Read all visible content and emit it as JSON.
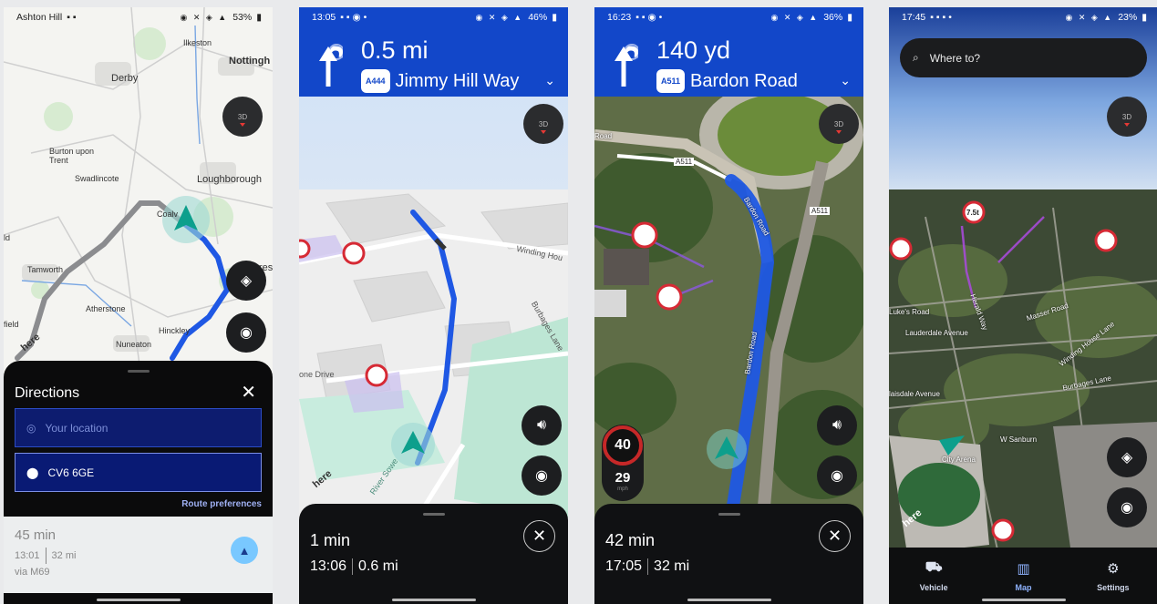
{
  "screens": [
    {
      "status": {
        "time": "Ashton Hill",
        "right": "53%"
      },
      "map_labels": [
        "Derby",
        "Nottingh",
        "Ilkeston",
        "Burton upon Trent",
        "Swadlincote",
        "Loughborough",
        "Coalv",
        "Tamworth",
        "Atherstone",
        "Hinckley",
        "Nuneaton",
        "field",
        "ld",
        "res",
        "here"
      ],
      "compass": "3D",
      "directions": {
        "title": "Directions",
        "origin": "Your location",
        "destination": "CV6 6GE",
        "route_prefs": "Route preferences"
      },
      "route": {
        "duration": "45 min",
        "arrival": "13:01",
        "distance": "32 mi",
        "via": "via M69"
      }
    },
    {
      "status": {
        "time": "13:05",
        "right": "46%"
      },
      "maneuver": {
        "distance": "0.5 mi",
        "road_number": "A444",
        "road_name": "Jimmy Hill Way"
      },
      "compass": "3D",
      "map_labels": [
        "Winding Hou",
        "Burbages Lane",
        "one Drive",
        "River Sowe",
        "here"
      ],
      "trip": {
        "remaining": "1 min",
        "arrival": "13:06",
        "distance": "0.6 mi"
      }
    },
    {
      "status": {
        "time": "16:23",
        "right": "36%"
      },
      "maneuver": {
        "distance": "140 yd",
        "road_number": "A511",
        "road_name": "Bardon Road"
      },
      "compass": "3D",
      "map_labels": [
        "Road",
        "A511",
        "A511",
        "Bardon Road",
        "Bardon Road"
      ],
      "speed": {
        "limit": "40",
        "current": "29",
        "unit": "mph"
      },
      "trip": {
        "remaining": "42 min",
        "arrival": "17:05",
        "distance": "32 mi"
      }
    },
    {
      "status": {
        "time": "17:45",
        "right": "23%"
      },
      "search_placeholder": "Where to?",
      "compass": "3D",
      "map_labels": [
        "7.5t",
        "Lauderdale Avenue",
        "Luke's Road",
        "Masser Road",
        "Winding House Lane",
        "Burbages Lane",
        "laisdale Avenue",
        "Herald Way",
        "W Sanburn",
        "City Arena",
        "here"
      ],
      "tabs": [
        {
          "label": "Vehicle"
        },
        {
          "label": "Map"
        },
        {
          "label": "Settings"
        }
      ]
    }
  ]
}
